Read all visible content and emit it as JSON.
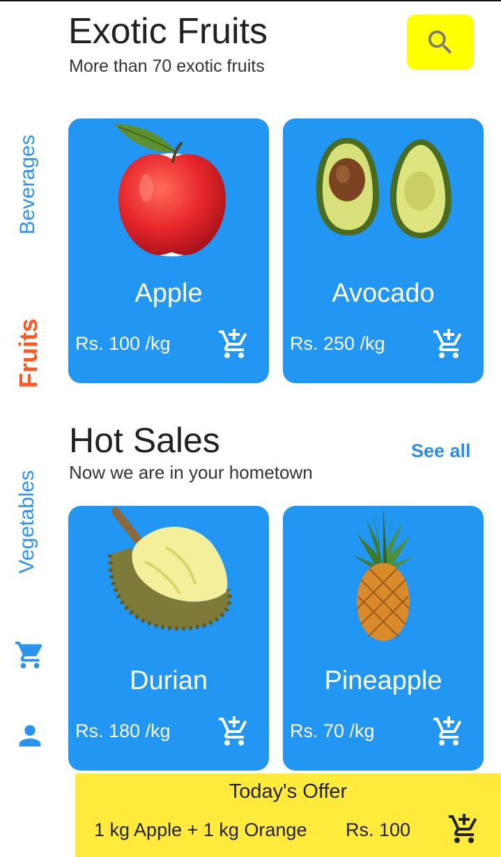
{
  "header": {
    "title": "Exotic Fruits",
    "subtitle": "More than 70 exotic fruits"
  },
  "sidebar": {
    "items": [
      {
        "label": "Beverages",
        "active": false
      },
      {
        "label": "Fruits",
        "active": true
      },
      {
        "label": "Vegetables",
        "active": false
      }
    ],
    "icons": [
      "cart-icon",
      "user-icon"
    ]
  },
  "featured": [
    {
      "name": "Apple",
      "price": "Rs. 100 /kg",
      "icon": "apple-image"
    },
    {
      "name": "Avocado",
      "price": "Rs. 250 /kg",
      "icon": "avocado-image"
    }
  ],
  "hot_sales": {
    "title": "Hot Sales",
    "subtitle": "Now we are in your hometown",
    "see_all": "See all",
    "items": [
      {
        "name": "Durian",
        "price": "Rs. 180 /kg",
        "icon": "durian-image"
      },
      {
        "name": "Pineapple",
        "price": "Rs. 70 /kg",
        "icon": "pineapple-image"
      }
    ]
  },
  "offer": {
    "title": "Today's Offer",
    "description": "1 kg Apple + 1 kg Orange",
    "price": "Rs. 100"
  },
  "colors": {
    "accent_blue": "#2196f3",
    "active_tab": "#ff5722",
    "search_button": "#ffff00",
    "offer_banner": "#ffeb3b"
  }
}
